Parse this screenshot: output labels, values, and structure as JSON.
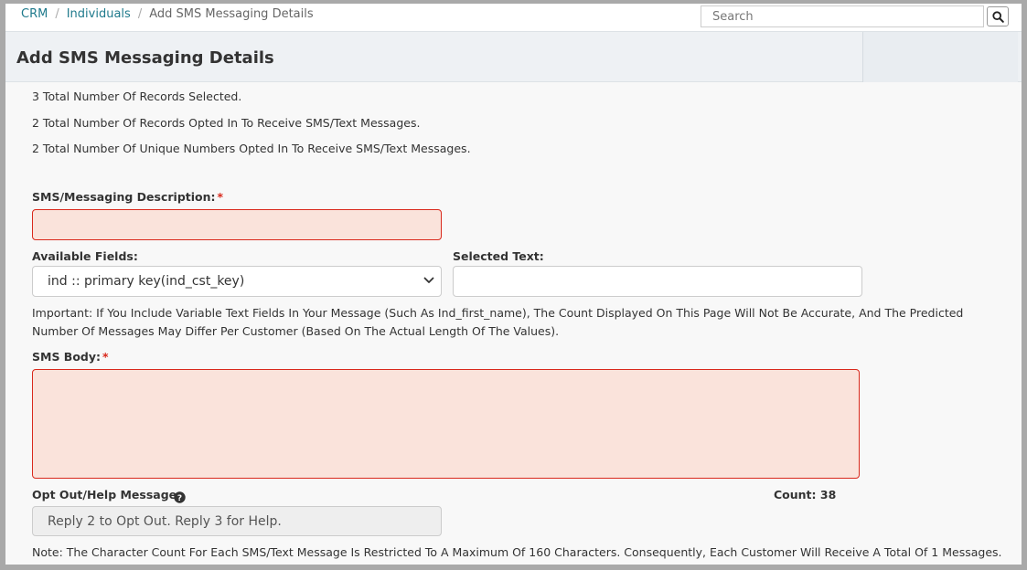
{
  "breadcrumb": {
    "items": [
      {
        "label": "CRM"
      },
      {
        "label": "Individuals"
      },
      {
        "label": "Add SMS Messaging Details"
      }
    ],
    "separator": "/"
  },
  "search": {
    "placeholder": "Search",
    "icon": "search-icon"
  },
  "header": {
    "title": "Add SMS Messaging Details"
  },
  "stats": [
    "3 Total Number Of Records Selected.",
    "2 Total Number Of Records Opted In To Receive SMS/Text Messages.",
    "2 Total Number Of Unique Numbers Opted In To Receive SMS/Text Messages."
  ],
  "form": {
    "description": {
      "label": "SMS/Messaging Description:",
      "required_mark": "*",
      "value": ""
    },
    "available_fields": {
      "label": "Available Fields:",
      "selected": "ind :: primary key(ind_cst_key)"
    },
    "selected_text": {
      "label": "Selected Text:",
      "value": ""
    },
    "important_note": "Important: If You Include Variable Text Fields In Your Message (Such As Ind_first_name), The Count Displayed On This Page Will Not Be Accurate, And The Predicted Number Of Messages May Differ Per Customer (Based On The Actual Length Of The Values).",
    "sms_body": {
      "label": "SMS Body:",
      "required_mark": "*",
      "value": ""
    },
    "opt_out": {
      "label": "Opt Out/Help Message:",
      "help_icon": "question-circle-icon",
      "value": "Reply 2 to Opt Out. Reply 3 for Help."
    },
    "count": "Count: 38",
    "footer_note": "Note: The Character Count For Each SMS/Text Message Is Restricted To A Maximum Of 160 Characters. Consequently, Each Customer Will Receive A Total Of 1 Messages."
  },
  "colors": {
    "link": "#1f7a8c",
    "required": "#d9291c",
    "error_bg": "#fae3db",
    "header_bg": "#eef1f4"
  }
}
